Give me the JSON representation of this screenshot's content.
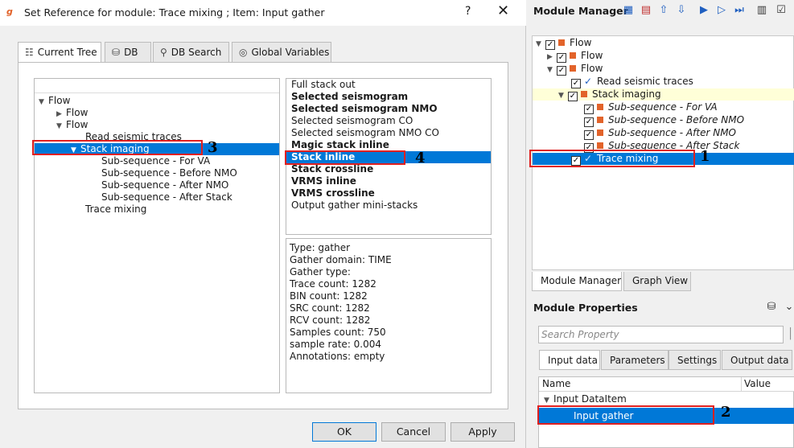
{
  "dialog": {
    "title": "Set Reference for module: Trace mixing ; Item: Input gather",
    "help": "?",
    "close": "✕",
    "tabs": [
      {
        "label": "Current Tree",
        "icon": "tree-icon"
      },
      {
        "label": "DB",
        "icon": "database-icon"
      },
      {
        "label": "DB Search",
        "icon": "search-icon"
      },
      {
        "label": "Global Variables",
        "icon": "globe-icon"
      }
    ],
    "tree": {
      "root": "Flow",
      "flow1": "Flow",
      "flow2": "Flow",
      "read": "Read seismic traces",
      "stack": "Stack imaging",
      "sub1": "Sub-sequence - For VA",
      "sub2": "Sub-sequence - Before NMO",
      "sub3": "Sub-sequence - After NMO",
      "sub4": "Sub-sequence - After Stack",
      "trace": "Trace mixing"
    },
    "list": [
      {
        "label": "Full stack out",
        "bold": false
      },
      {
        "label": "Selected seismogram",
        "bold": true
      },
      {
        "label": "Selected seismogram NMO",
        "bold": true
      },
      {
        "label": "Selected seismogram CO",
        "bold": false
      },
      {
        "label": "Selected seismogram NMO CO",
        "bold": false
      },
      {
        "label": "Magic stack inline",
        "bold": true
      },
      {
        "label": "Stack inline",
        "bold": true,
        "selected": true
      },
      {
        "label": "Stack crossline",
        "bold": true
      },
      {
        "label": "VRMS inline",
        "bold": true
      },
      {
        "label": "VRMS crossline",
        "bold": true
      },
      {
        "label": "Output gather mini-stacks",
        "bold": false
      }
    ],
    "info": [
      "Type: gather",
      "Gather domain:   TIME",
      "Gather type:",
      "Trace count:   1282",
      "BIN count:    1282",
      "SRC count:     1282",
      "RCV count:     1282",
      "Samples count: 750",
      "sample rate:  0.004",
      "Annotations:  empty"
    ],
    "buttons": {
      "ok": "OK",
      "cancel": "Cancel",
      "apply": "Apply"
    }
  },
  "annotations": {
    "n1": "1",
    "n2": "2",
    "n3": "3",
    "n4": "4"
  },
  "module_manager": {
    "title": "Module Manager",
    "tree": {
      "flow": "Flow",
      "flow1": "Flow",
      "flow2": "Flow",
      "read": "Read seismic traces",
      "stack": "Stack imaging",
      "sub1": "Sub-sequence - For VA",
      "sub2": "Sub-sequence - Before NMO",
      "sub3": "Sub-sequence - After NMO",
      "sub4": "Sub-sequence - After Stack",
      "trace": "Trace mixing"
    },
    "tabs": {
      "manager": "Module Manager",
      "graph": "Graph View"
    }
  },
  "module_properties": {
    "title": "Module Properties",
    "search_placeholder": "Search Property",
    "tabs": {
      "input": "Input data",
      "params": "Parameters",
      "settings": "Settings",
      "output": "Output data"
    },
    "columns": {
      "name": "Name",
      "value": "Value"
    },
    "group": "Input DataItem",
    "item": "Input gather"
  },
  "colors": {
    "accent": "#0078d7",
    "highlight": "#e02020",
    "node": "#e2632a"
  }
}
